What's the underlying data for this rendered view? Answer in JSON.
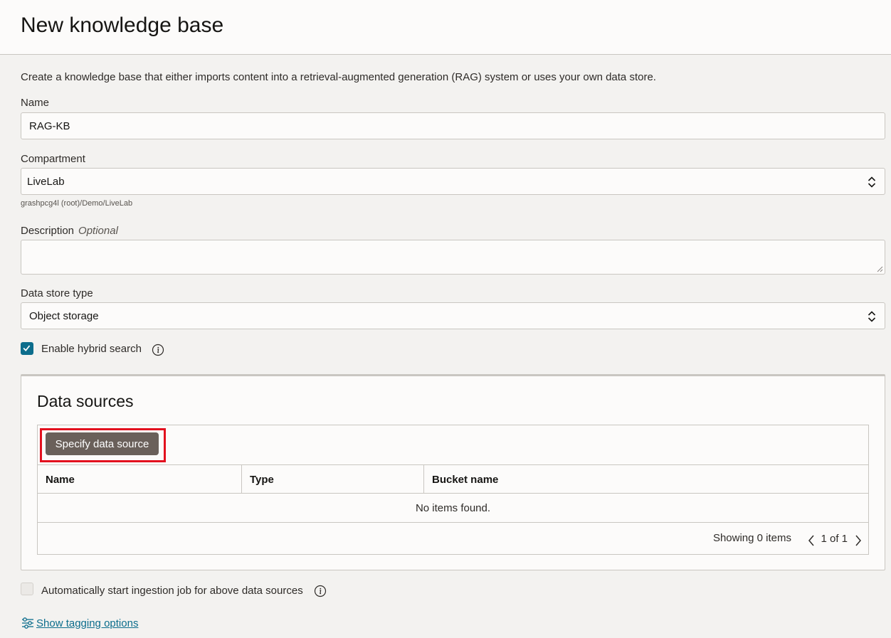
{
  "header": {
    "title": "New knowledge base"
  },
  "intro": "Create a knowledge base that either imports content into a retrieval-augmented generation (RAG) system or uses your own data store.",
  "form": {
    "name": {
      "label": "Name",
      "value": "RAG-KB"
    },
    "compartment": {
      "label": "Compartment",
      "value": "LiveLab",
      "path": "grashpcg4l (root)/Demo/LiveLab"
    },
    "description": {
      "label": "Description",
      "optional": "Optional",
      "value": ""
    },
    "data_store_type": {
      "label": "Data store type",
      "value": "Object storage"
    },
    "hybrid_search": {
      "label": "Enable hybrid search",
      "checked": true
    }
  },
  "data_sources": {
    "title": "Data sources",
    "specify_button": "Specify data source",
    "columns": [
      "Name",
      "Type",
      "Bucket name"
    ],
    "empty_text": "No items found.",
    "showing": "Showing 0 items",
    "page_info": "1 of 1"
  },
  "auto_ingest": {
    "label": "Automatically start ingestion job for above data sources",
    "checked": false
  },
  "tagging_link": "Show tagging options",
  "colors": {
    "accent": "#0c6d8c",
    "button": "#6a605a",
    "highlight": "#e3101e"
  }
}
